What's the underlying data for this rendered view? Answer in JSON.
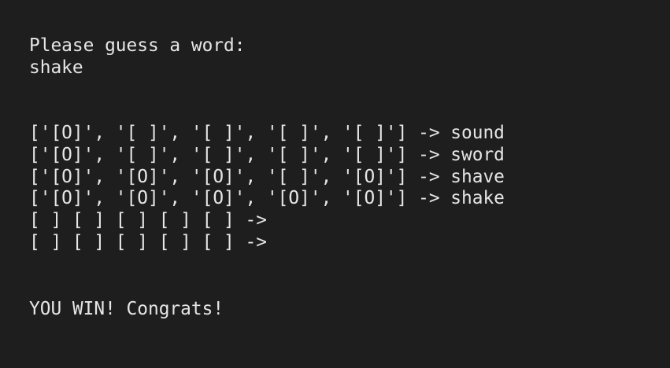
{
  "terminal": {
    "prompt": "Please guess a word:",
    "input_value": "shake",
    "board_rows": [
      "['[O]', '[ ]', '[ ]', '[ ]', '[ ]'] -> sound",
      "['[O]', '[ ]', '[ ]', '[ ]', '[ ]'] -> sword",
      "['[O]', '[O]', '[O]', '[ ]', '[O]'] -> shave",
      "['[O]', '[O]', '[O]', '[O]', '[O]'] -> shake",
      "[ ] [ ] [ ] [ ] [ ] ->",
      "[ ] [ ] [ ] [ ] [ ] ->"
    ],
    "result": "YOU WIN! Congrats!"
  }
}
